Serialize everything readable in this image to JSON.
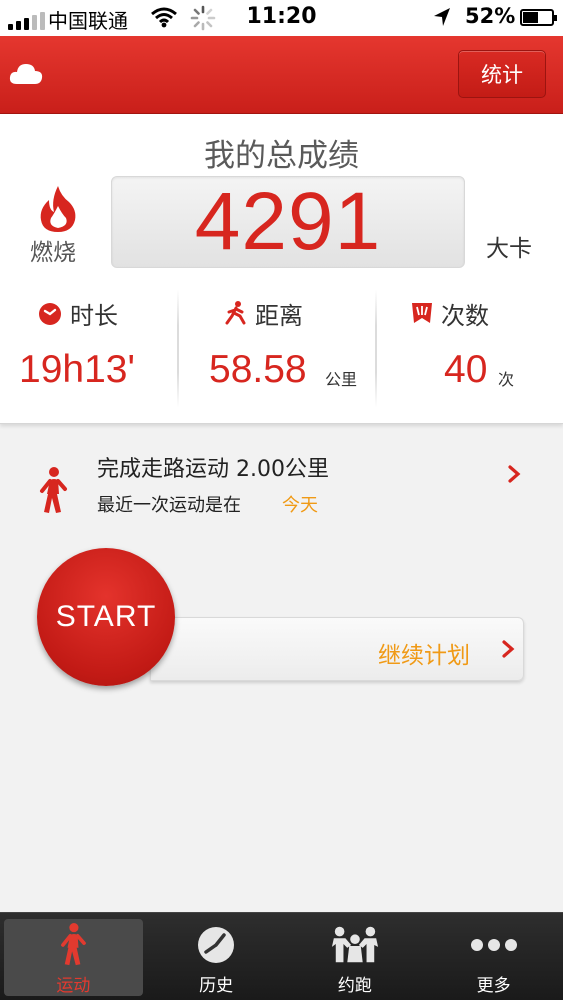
{
  "status_bar": {
    "carrier": "中国联通",
    "time": "11:20",
    "battery": "52%"
  },
  "header": {
    "stats_label": "统计"
  },
  "summary": {
    "title": "我的总成绩",
    "burn_label": "燃烧",
    "calories": "4291",
    "calorie_unit": "大卡",
    "duration": {
      "label": "时长",
      "value": "19h13'"
    },
    "distance": {
      "label": "距离",
      "value": "58.58",
      "unit": "公里"
    },
    "count": {
      "label": "次数",
      "value": "40",
      "unit": "次"
    }
  },
  "plan": {
    "title": "完成走路运动 2.00公里",
    "last_prefix": "最近一次运动是在",
    "last_value": "今天",
    "continue_label": "继续计划",
    "start_label": "START"
  },
  "tabs": [
    {
      "label": "运动",
      "icon": "walker-icon",
      "active": true
    },
    {
      "label": "历史",
      "icon": "history-icon",
      "active": false
    },
    {
      "label": "约跑",
      "icon": "group-run-icon",
      "active": false
    },
    {
      "label": "更多",
      "icon": "more-dots-icon",
      "active": false
    }
  ],
  "colors": {
    "accent_red": "#d7261f",
    "orange": "#f09a16",
    "tab_active": "#e23a2f"
  }
}
